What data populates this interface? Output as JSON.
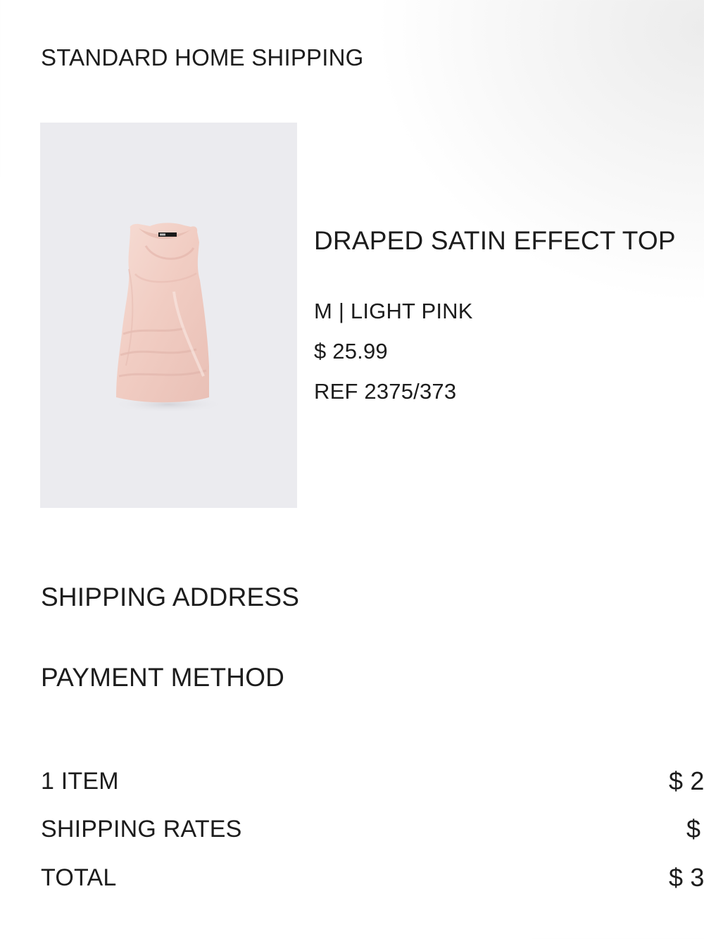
{
  "shipping": {
    "method_title": "STANDARD HOME SHIPPING"
  },
  "product": {
    "name": "DRAPED SATIN EFFECT TOP",
    "variant": "M | LIGHT PINK",
    "price": "$ 25.99",
    "ref": "REF 2375/373",
    "image_icon": "pink-satin-top-photo",
    "color": "#f3d2ca"
  },
  "sections": {
    "shipping_address": "SHIPPING ADDRESS",
    "payment_method": "PAYMENT METHOD"
  },
  "summary": {
    "items_label": "1 ITEM",
    "items_value": "$ 2",
    "shipping_label": "SHIPPING RATES",
    "shipping_value": "$",
    "total_label": "TOTAL",
    "total_value": "$ 3"
  }
}
